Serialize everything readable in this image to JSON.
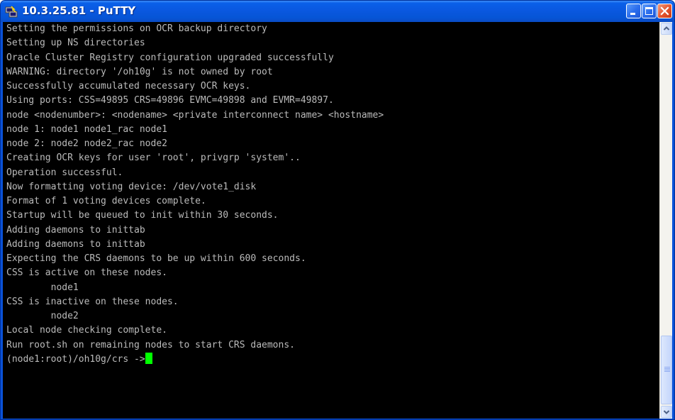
{
  "window": {
    "title": "10.3.25.81 - PuTTY"
  },
  "icons": {
    "app": "putty-icon",
    "minimize": "minimize-icon",
    "maximize": "maximize-icon",
    "close": "close-icon",
    "scroll_up": "scroll-up-arrow-icon",
    "scroll_down": "scroll-down-arrow-icon"
  },
  "colors": {
    "terminal_bg": "#000000",
    "terminal_fg": "#bbbbbb",
    "cursor": "#00ff00",
    "titlebar": "#0a58e0"
  },
  "terminal": {
    "lines": [
      "Setting the permissions on OCR backup directory",
      "Setting up NS directories",
      "Oracle Cluster Registry configuration upgraded successfully",
      "WARNING: directory '/oh10g' is not owned by root",
      "Successfully accumulated necessary OCR keys.",
      "Using ports: CSS=49895 CRS=49896 EVMC=49898 and EVMR=49897.",
      "node <nodenumber>: <nodename> <private interconnect name> <hostname>",
      "node 1: node1 node1_rac node1",
      "node 2: node2 node2_rac node2",
      "Creating OCR keys for user 'root', privgrp 'system'..",
      "Operation successful.",
      "Now formatting voting device: /dev/vote1_disk",
      "Format of 1 voting devices complete.",
      "Startup will be queued to init within 30 seconds.",
      "Adding daemons to inittab",
      "Adding daemons to inittab",
      "Expecting the CRS daemons to be up within 600 seconds.",
      "CSS is active on these nodes.",
      "        node1",
      "CSS is inactive on these nodes.",
      "        node2",
      "Local node checking complete.",
      "Run root.sh on remaining nodes to start CRS daemons."
    ],
    "prompt": "(node1:root)/oh10g/crs ->"
  }
}
